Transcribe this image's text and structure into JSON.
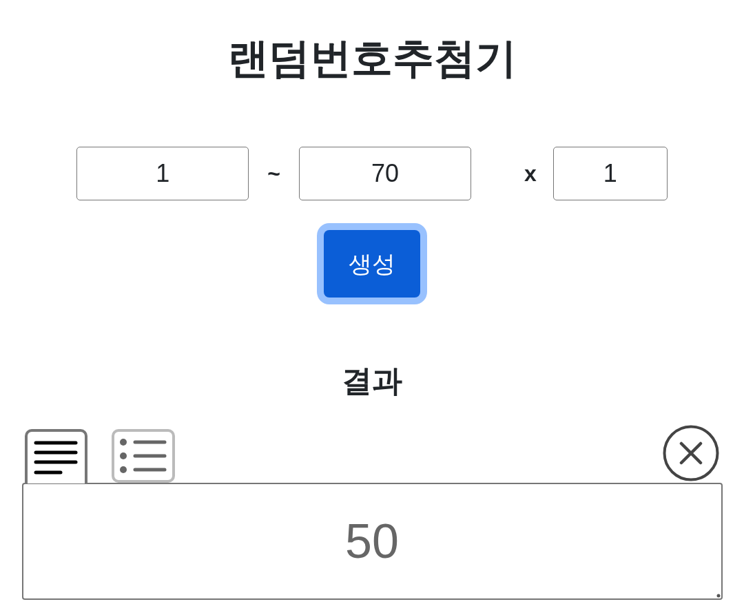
{
  "title": "랜덤번호추첨기",
  "range": {
    "min": {
      "value": "1"
    },
    "separator": "~",
    "max": {
      "value": "70"
    },
    "times_sign": "x",
    "count": {
      "value": "1"
    }
  },
  "generate_button": {
    "label": "생성",
    "focused": true
  },
  "result": {
    "heading": "결과",
    "tabs": [
      {
        "selected": true
      },
      {
        "selected": false
      }
    ],
    "value": "50"
  }
}
